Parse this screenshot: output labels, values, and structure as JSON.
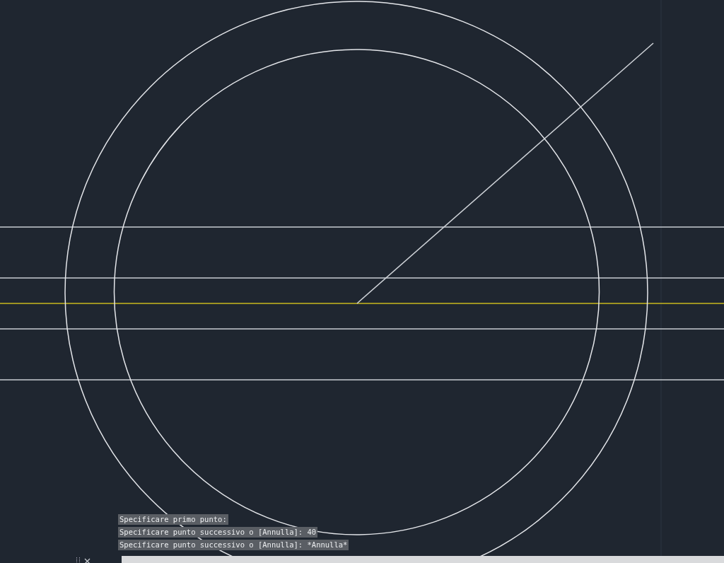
{
  "command_history": [
    "Specificare primo punto:",
    "Specificare punto successivo o [Annulla]: 40",
    "Specificare punto successivo o [Annulla]: *Annulla*"
  ]
}
